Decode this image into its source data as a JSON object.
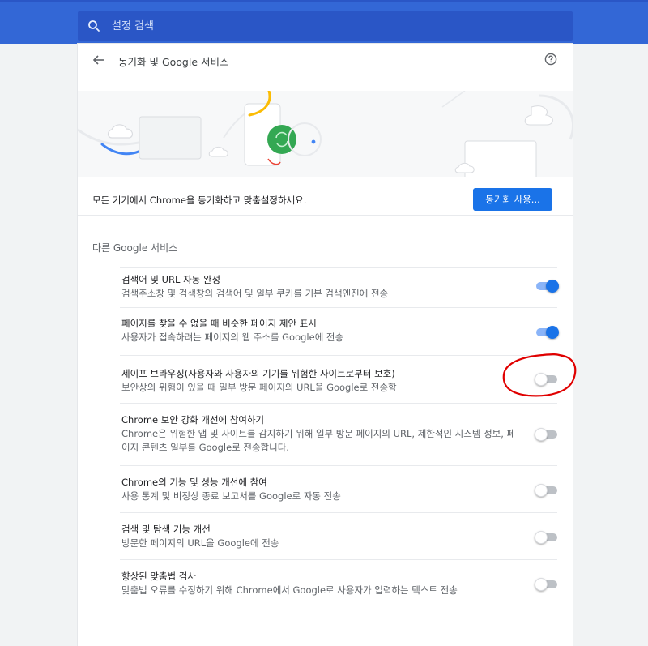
{
  "search": {
    "placeholder": "설정 검색",
    "icon": "search-icon"
  },
  "header": {
    "title": "동기화 및 Google 서비스",
    "back_icon": "arrow-left-icon",
    "help_icon": "help-circle-icon"
  },
  "sync": {
    "text": "모든 기기에서 Chrome을 동기화하고 맞춤설정하세요.",
    "button_label": "동기화 사용..."
  },
  "services": {
    "section_title": "다른 Google 서비스",
    "items": [
      {
        "title": "검색어 및 URL 자동 완성",
        "desc": "검색주소창 및 검색창의 검색어 및 일부 쿠키를 기본 검색엔진에 전송",
        "enabled": true
      },
      {
        "title": "페이지를 찾을 수 없을 때 비슷한 페이지 제안 표시",
        "desc": "사용자가 접속하려는 페이지의 웹 주소를 Google에 전송",
        "enabled": true
      },
      {
        "title": "세이프 브라우징(사용자와 사용자의 기기를 위험한 사이트로부터 보호)",
        "desc": "보안상의 위험이 있을 때 일부 방문 페이지의 URL을 Google로 전송함",
        "enabled": false
      },
      {
        "title": "Chrome 보안 강화 개선에 참여하기",
        "desc": "Chrome은 위험한 앱 및 사이트를 감지하기 위해 일부 방문 페이지의 URL, 제한적인 시스템 정보, 페이지 콘텐츠 일부를 Google로 전송합니다.",
        "enabled": false
      },
      {
        "title": "Chrome의 기능 및 성능 개선에 참여",
        "desc": "사용 통계 및 비정상 종료 보고서를 Google로 자동 전송",
        "enabled": false
      },
      {
        "title": "검색 및 탐색 기능 개선",
        "desc": "방문한 페이지의 URL을 Google에 전송",
        "enabled": false
      },
      {
        "title": "향상된 맞춤법 검사",
        "desc": "맞춤법 오류를 수정하기 위해 Chrome에서 Google로 사용자가 입력하는 텍스트 전송",
        "enabled": false
      }
    ]
  },
  "colors": {
    "header_blue": "#3367d6",
    "accent": "#1a73e8",
    "annotation": "#e00000"
  }
}
